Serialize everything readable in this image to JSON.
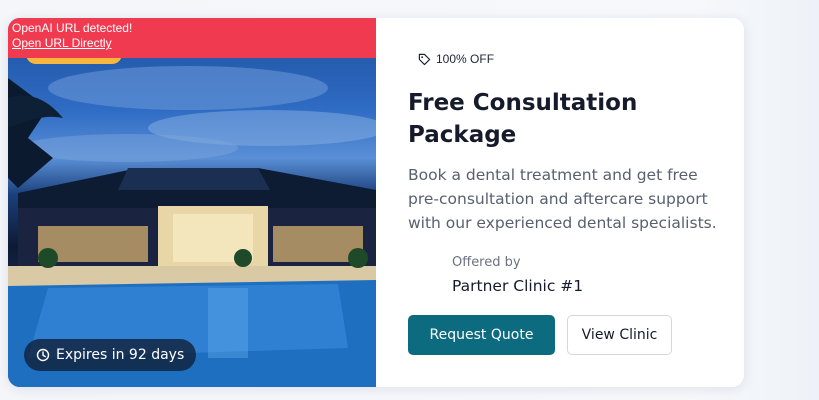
{
  "alert": {
    "message": "OpenAI URL detected!",
    "link_label": "Open URL Directly"
  },
  "media": {
    "expires_label": "Expires in 92 days",
    "expires_icon": "clock-icon"
  },
  "offer": {
    "discount_label": "100% OFF",
    "discount_icon": "tag-icon",
    "title": "Free Consultation Package",
    "description": "Book a dental treatment and get free pre-consultation and aftercare support with our experienced dental specialists.",
    "offered_by_label": "Offered by",
    "offered_by_value": "Partner Clinic #1"
  },
  "actions": {
    "primary_label": "Request Quote",
    "secondary_label": "View Clinic"
  },
  "colors": {
    "alert_bg": "#ef3a4f",
    "primary_button": "#0d6b80",
    "badge_accent": "#f6b73c"
  }
}
